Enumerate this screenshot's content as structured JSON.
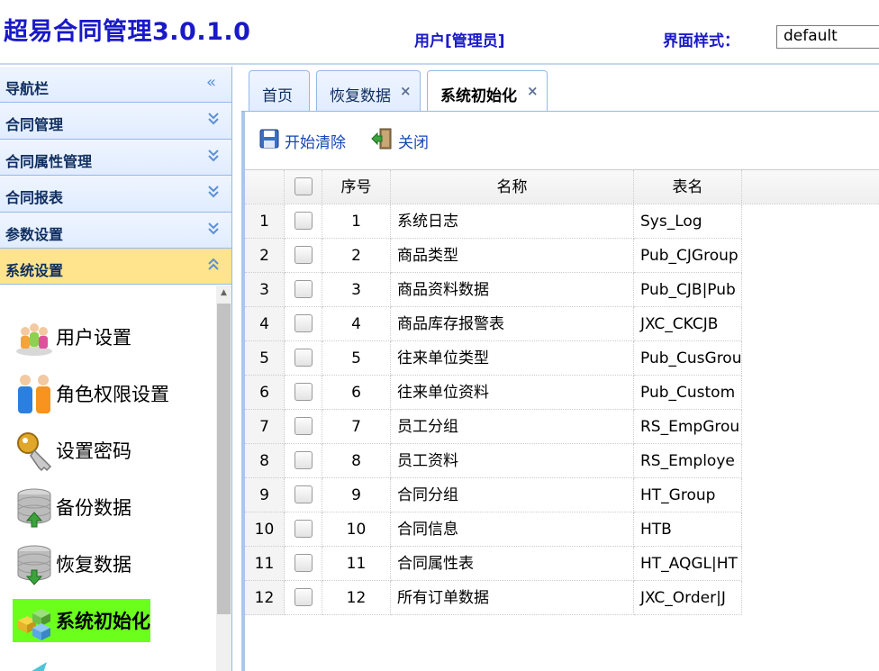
{
  "header": {
    "app_title": "超易合同管理3.0.1.0",
    "user_label": "用户[管理员]",
    "theme_label": "界面样式：",
    "theme_value": "default"
  },
  "nav": {
    "title": "导航栏",
    "sections": [
      {
        "label": "合同管理",
        "expanded": false
      },
      {
        "label": "合同属性管理",
        "expanded": false
      },
      {
        "label": "合同报表",
        "expanded": false
      },
      {
        "label": "参数设置",
        "expanded": false
      },
      {
        "label": "系统设置",
        "expanded": true
      }
    ],
    "items": [
      {
        "label": "用户设置",
        "icon": "users-icon"
      },
      {
        "label": "角色权限设置",
        "icon": "roles-icon"
      },
      {
        "label": "设置密码",
        "icon": "key-icon"
      },
      {
        "label": "备份数据",
        "icon": "database-backup-icon"
      },
      {
        "label": "恢复数据",
        "icon": "database-restore-icon"
      },
      {
        "label": "系统初始化",
        "icon": "init-cubes-icon",
        "active": true
      }
    ]
  },
  "tabs": [
    {
      "label": "首页",
      "closable": false
    },
    {
      "label": "恢复数据",
      "closable": true
    },
    {
      "label": "系统初始化",
      "closable": true,
      "selected": true
    }
  ],
  "toolbar": {
    "start_clear_label": "开始清除",
    "close_label": "关闭"
  },
  "grid": {
    "columns": {
      "seq": "序号",
      "name": "名称",
      "table": "表名"
    },
    "rows": [
      {
        "rownum": "1",
        "seq": "1",
        "name": "系统日志",
        "table": "Sys_Log"
      },
      {
        "rownum": "2",
        "seq": "2",
        "name": "商品类型",
        "table": "Pub_CJGroup"
      },
      {
        "rownum": "3",
        "seq": "3",
        "name": "商品资料数据",
        "table": "Pub_CJB|Pub"
      },
      {
        "rownum": "4",
        "seq": "4",
        "name": "商品库存报警表",
        "table": "JXC_CKCJB"
      },
      {
        "rownum": "5",
        "seq": "5",
        "name": "往来单位类型",
        "table": "Pub_CusGrou"
      },
      {
        "rownum": "6",
        "seq": "6",
        "name": "往来单位资料",
        "table": "Pub_Custom"
      },
      {
        "rownum": "7",
        "seq": "7",
        "name": "员工分组",
        "table": "RS_EmpGrou"
      },
      {
        "rownum": "8",
        "seq": "8",
        "name": "员工资料",
        "table": "RS_Employe"
      },
      {
        "rownum": "9",
        "seq": "9",
        "name": "合同分组",
        "table": "HT_Group"
      },
      {
        "rownum": "10",
        "seq": "10",
        "name": "合同信息",
        "table": "HTB"
      },
      {
        "rownum": "11",
        "seq": "11",
        "name": "合同属性表",
        "table": "HT_AQGL|HT"
      },
      {
        "rownum": "12",
        "seq": "12",
        "name": "所有订单数据",
        "table": "JXC_Order|J"
      }
    ]
  },
  "colors": {
    "title_blue": "#1919c8",
    "nav_border": "#95b8e7",
    "selected_section": "#ffe48d",
    "active_item": "#6cff1c"
  }
}
